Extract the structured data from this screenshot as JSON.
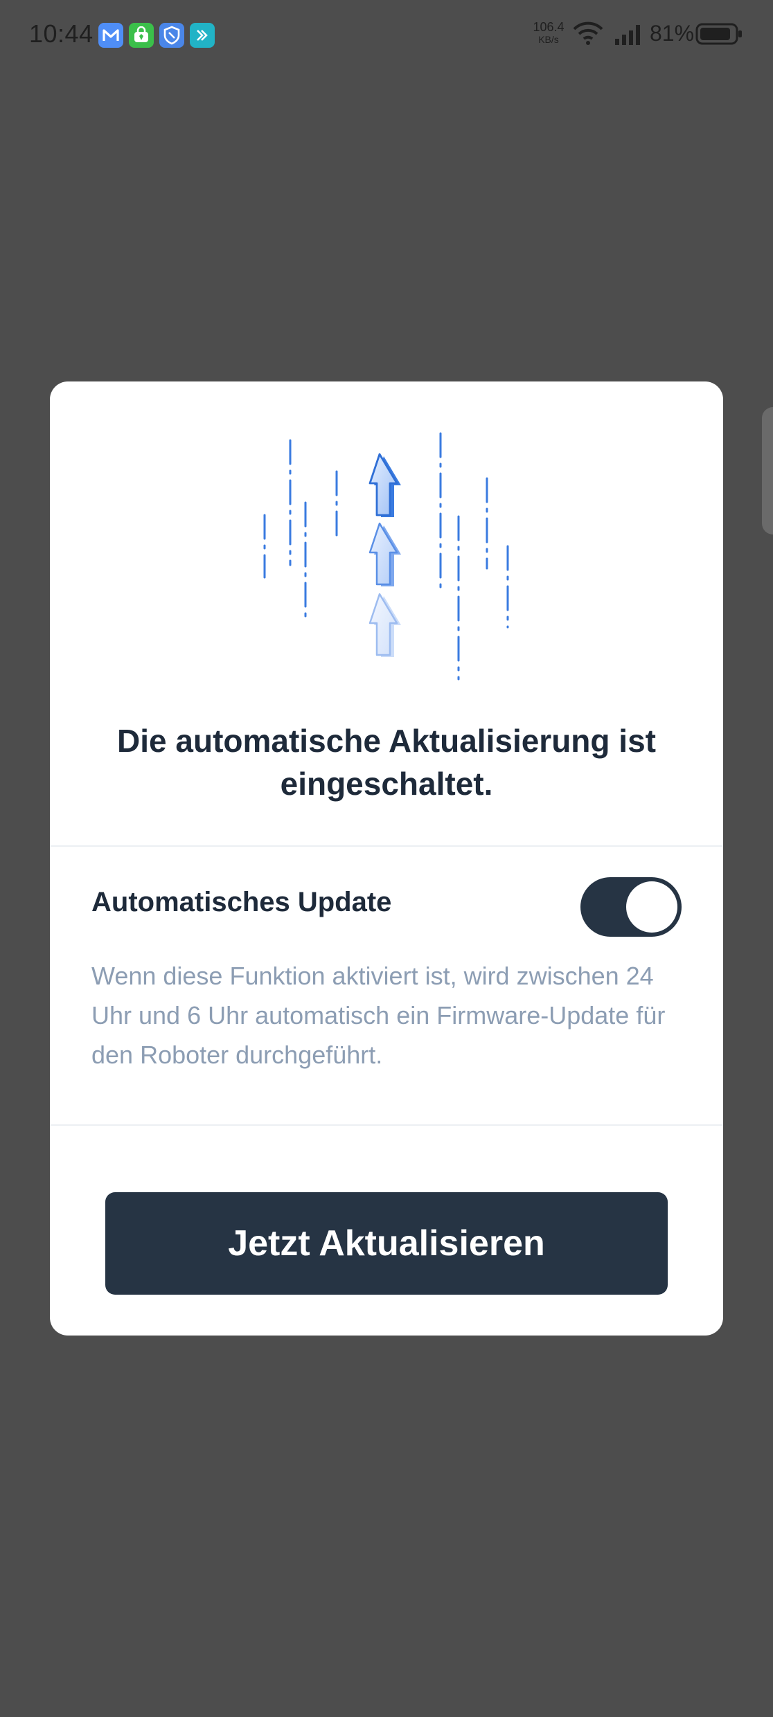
{
  "status_bar": {
    "time": "10:44",
    "net_speed_value": "106.4",
    "net_speed_unit": "KB/s",
    "battery_percent": "81%",
    "notification_icons": [
      "mail-app-icon",
      "security-app-icon",
      "shield-app-icon",
      "chat-app-icon"
    ]
  },
  "dialog": {
    "illustration_icon": "upload-arrows-icon",
    "title": "Die automatische Aktualisierung ist eingeschaltet.",
    "setting": {
      "label": "Automatisches Update",
      "enabled": true,
      "description": "Wenn diese Funktion aktiviert ist, wird zwischen 24 Uhr und 6 Uhr automatisch ein Firmware-Update für den Roboter durchgeführt."
    },
    "primary_button": "Jetzt Aktualisieren"
  },
  "colors": {
    "overlay": "#4d4d4d",
    "dialog_bg": "#ffffff",
    "dark_navy": "#263444",
    "title_text": "#1e2a3a",
    "description_text": "#8c9db3",
    "illustration_blue": "#3a7be0"
  }
}
